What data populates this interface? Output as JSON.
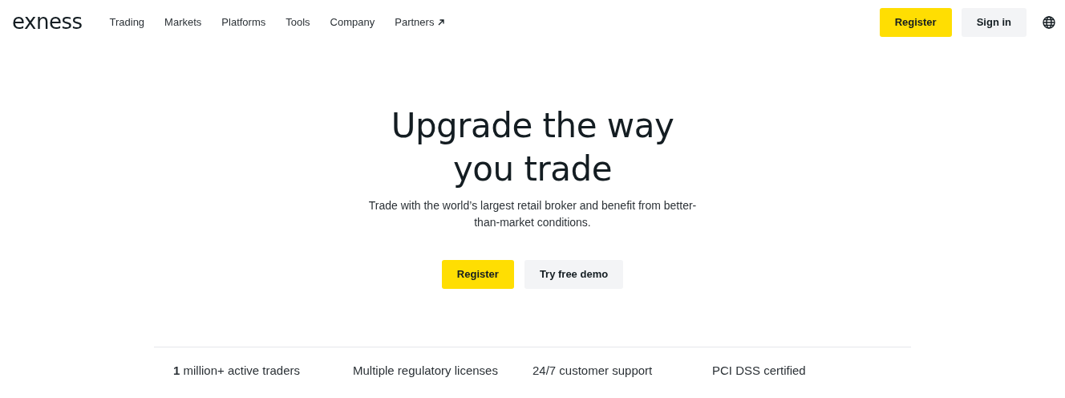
{
  "logo": "exness",
  "nav": [
    {
      "label": "Trading",
      "external": false
    },
    {
      "label": "Markets",
      "external": false
    },
    {
      "label": "Platforms",
      "external": false
    },
    {
      "label": "Tools",
      "external": false
    },
    {
      "label": "Company",
      "external": false
    },
    {
      "label": "Partners",
      "external": true
    }
  ],
  "header_buttons": [
    {
      "label": "Register",
      "kind": "primary"
    },
    {
      "label": "Sign in",
      "kind": "secondary"
    }
  ],
  "hero": {
    "title": "Upgrade the way you trade",
    "subtitle": "Trade with the world’s largest retail broker and benefit from better-than-market conditions.",
    "buttons": [
      {
        "label": "Register",
        "kind": "primary"
      },
      {
        "label": "Try free demo",
        "kind": "secondary"
      }
    ]
  },
  "stats": [
    "**1** million+ active traders",
    "Multiple regulatory licenses",
    "24/7 customer support",
    "PCI DSS certified"
  ]
}
